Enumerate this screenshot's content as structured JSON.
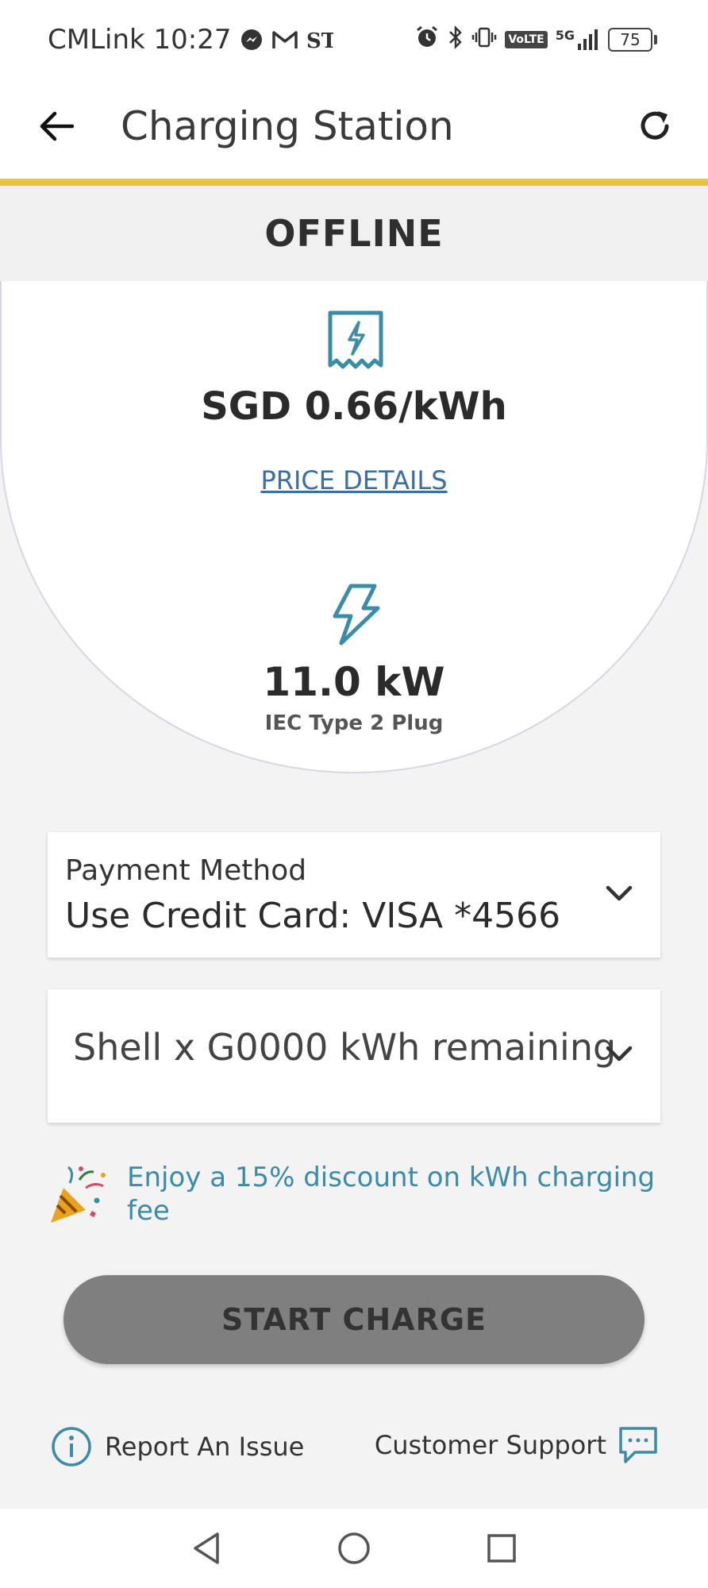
{
  "status_bar": {
    "carrier_time": "CMLink 10:27",
    "net_label": "5G",
    "volte": "VoLTE",
    "battery": "75"
  },
  "app_bar": {
    "title": "Charging Station",
    "back_icon": "arrow-left-icon",
    "refresh_icon": "refresh-icon"
  },
  "station": {
    "status": "OFFLINE",
    "price": "SGD 0.66/kWh",
    "price_details_link": "PRICE DETAILS",
    "power": "11.0 kW",
    "plug_type": "IEC Type 2 Plug"
  },
  "payment": {
    "label": "Payment Method",
    "value": "Use Credit Card: VISA *4566"
  },
  "package": {
    "value": "Shell x G0000 kWh remaining"
  },
  "discount": {
    "text": "Enjoy a 15% discount on kWh charging fee"
  },
  "start_button": {
    "label": "START CHARGE"
  },
  "footer": {
    "report": "Report An Issue",
    "support": "Customer Support"
  },
  "colors": {
    "accent": "#e7c43a",
    "teal": "#3a8ca8",
    "link": "#3b6ea5",
    "disabled_button": "#7f7f7f"
  }
}
